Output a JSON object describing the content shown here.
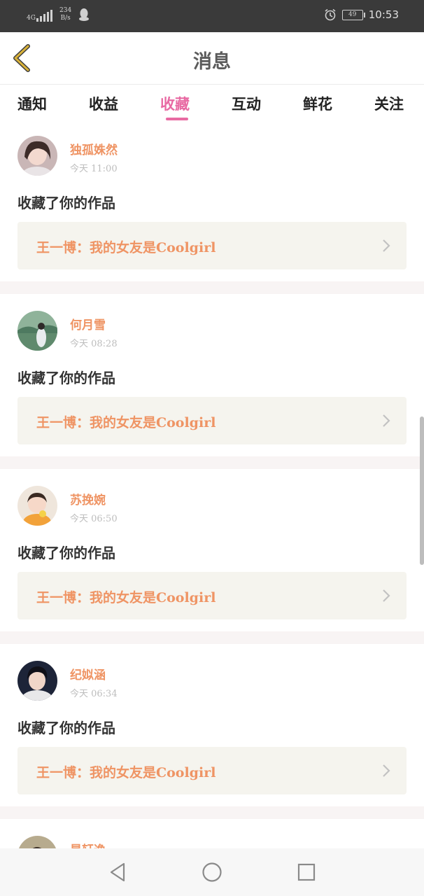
{
  "status_bar": {
    "network": "4G",
    "speed": [
      "234",
      "B/s"
    ],
    "battery": "49",
    "time": "10:53"
  },
  "header": {
    "title": "消息"
  },
  "tabs": [
    {
      "label": "通知",
      "active": false
    },
    {
      "label": "收益",
      "active": false
    },
    {
      "label": "收藏",
      "active": true
    },
    {
      "label": "互动",
      "active": false
    },
    {
      "label": "鲜花",
      "active": false
    },
    {
      "label": "关注",
      "active": false
    }
  ],
  "messages": [
    {
      "name": "独孤姝然",
      "time": "今天 11:00",
      "action": "收藏了你的作品",
      "work": "王一博：我的女友是Coolgirl",
      "avatar_color": "#b9a9a9"
    },
    {
      "name": "何月雪",
      "time": "今天 08:28",
      "action": "收藏了你的作品",
      "work": "王一博：我的女友是Coolgirl",
      "avatar_color": "#6f9a7c"
    },
    {
      "name": "苏挽婉",
      "time": "今天 06:50",
      "action": "收藏了你的作品",
      "work": "王一博：我的女友是Coolgirl",
      "avatar_color": "#e8a23a"
    },
    {
      "name": "纪姒涵",
      "time": "今天 06:34",
      "action": "收藏了你的作品",
      "work": "王一博：我的女友是Coolgirl",
      "avatar_color": "#1e2a44"
    }
  ],
  "partial_message": {
    "name": "是轩逸",
    "avatar_color": "#9a8a6a"
  },
  "colors": {
    "accent": "#e86aa3",
    "name": "#ef9464",
    "back_icon": "#d9b23a"
  },
  "nav_icons": [
    "back-triangle-icon",
    "home-circle-icon",
    "recent-square-icon"
  ]
}
